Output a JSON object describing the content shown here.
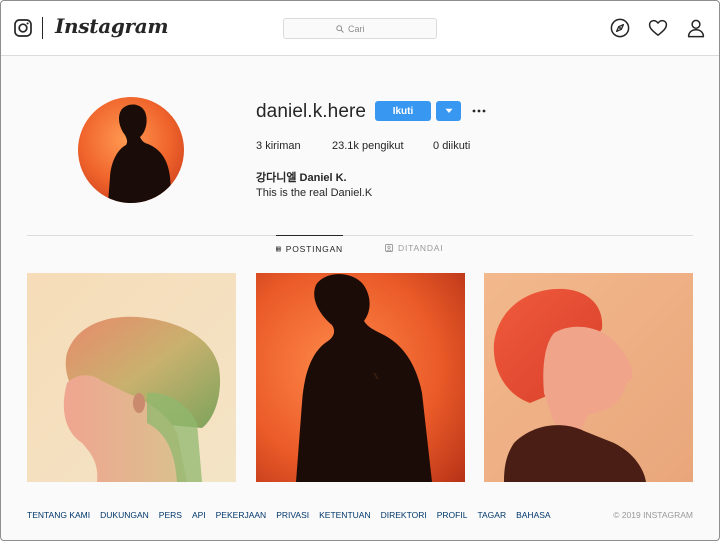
{
  "header": {
    "brand": "Instagram",
    "search": {
      "placeholder": "Cari",
      "value": ""
    },
    "icons": [
      "instagram-camera-icon",
      "compass-icon",
      "heart-icon",
      "person-icon"
    ]
  },
  "profile": {
    "username": "daniel.k.here",
    "follow_label": "Ikuti",
    "posts_count": "3",
    "posts_label": "kiriman",
    "followers_count": "23.1k",
    "followers_label": "pengikut",
    "following_count": "0",
    "following_label": "diikuti",
    "full_name": "강다니엘 Daniel K.",
    "bio": "This is the real Daniel.K"
  },
  "tabs": [
    {
      "label": "POSTINGAN",
      "active": true,
      "icon": "grid-icon"
    },
    {
      "label": "DITANDAI",
      "active": false,
      "icon": "tagged-icon"
    }
  ],
  "footer": {
    "links": [
      "TENTANG KAMI",
      "DUKUNGAN",
      "PERS",
      "API",
      "PEKERJAAN",
      "PRIVASI",
      "KETENTUAN",
      "DIREKTORI",
      "PROFIL",
      "TAGAR",
      "BAHASA"
    ],
    "copyright": "© 2019 INSTAGRAM"
  },
  "colors": {
    "accent": "#3897f0",
    "link": "#00376b",
    "border": "#dbdbdb"
  }
}
